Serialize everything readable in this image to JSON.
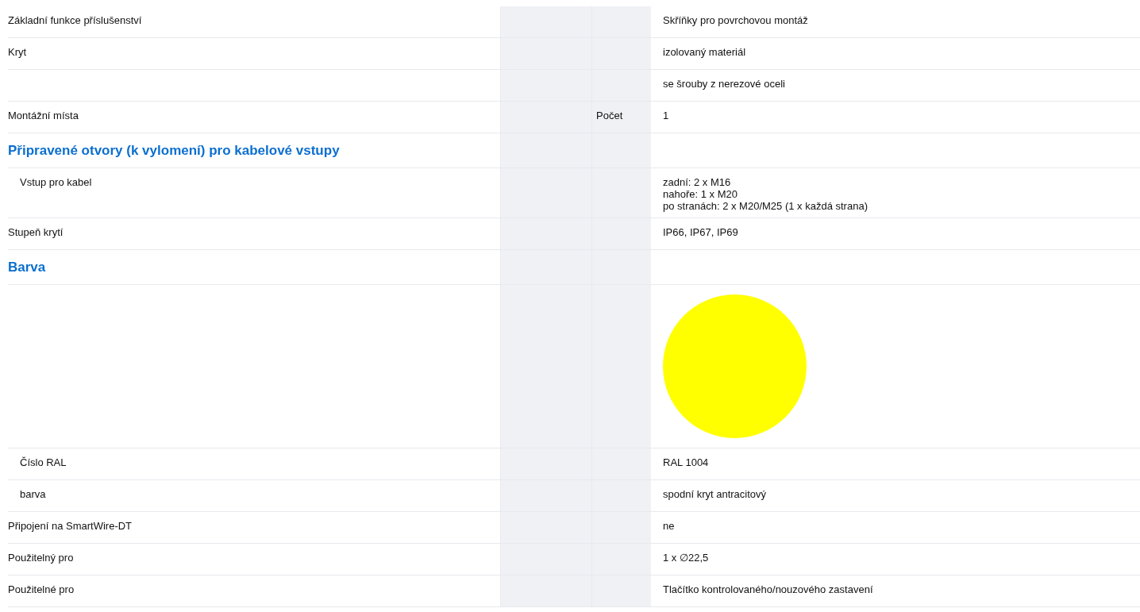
{
  "rows": [
    {
      "kind": "row",
      "label": "Základní funkce příslušenství",
      "value": [
        "Skříňky pro povrchovou montáž"
      ]
    },
    {
      "kind": "row",
      "label": "Kryt",
      "value": [
        "izolovaný materiál"
      ]
    },
    {
      "kind": "row",
      "label": "",
      "value": [
        "se šrouby z nerezové oceli"
      ]
    },
    {
      "kind": "row",
      "label": "Montážní místa",
      "unit": "Počet",
      "value": [
        "1"
      ]
    },
    {
      "kind": "section",
      "label": "Připravené otvory (k vylomení) pro kabelové vstupy",
      "children": [
        {
          "kind": "row",
          "label": "Vstup pro kabel",
          "value": [
            "zadní: 2 x M16",
            "nahoře: 1 x M20",
            "po stranách: 2 x M20/M25 (1 x každá strana)"
          ]
        }
      ]
    },
    {
      "kind": "row",
      "label": "Stupeň krytí",
      "value": [
        "IP66, IP67, IP69"
      ]
    },
    {
      "kind": "section",
      "label": "Barva",
      "children": [
        {
          "kind": "swatch",
          "color": "#ffff00"
        },
        {
          "kind": "row",
          "label": "Číslo RAL",
          "value": [
            "RAL 1004"
          ]
        },
        {
          "kind": "row",
          "label": "barva",
          "value": [
            "spodní kryt antracitový"
          ]
        }
      ]
    },
    {
      "kind": "row",
      "label": "Připojení na SmartWire-DT",
      "value": [
        "ne"
      ]
    },
    {
      "kind": "row",
      "label": "Použitelný pro",
      "value": [
        "1 x ∅22,5"
      ]
    },
    {
      "kind": "row",
      "label": "Použitelné pro",
      "value": [
        "Tlačítko kontrolovaného/nouzového zastavení"
      ]
    }
  ]
}
